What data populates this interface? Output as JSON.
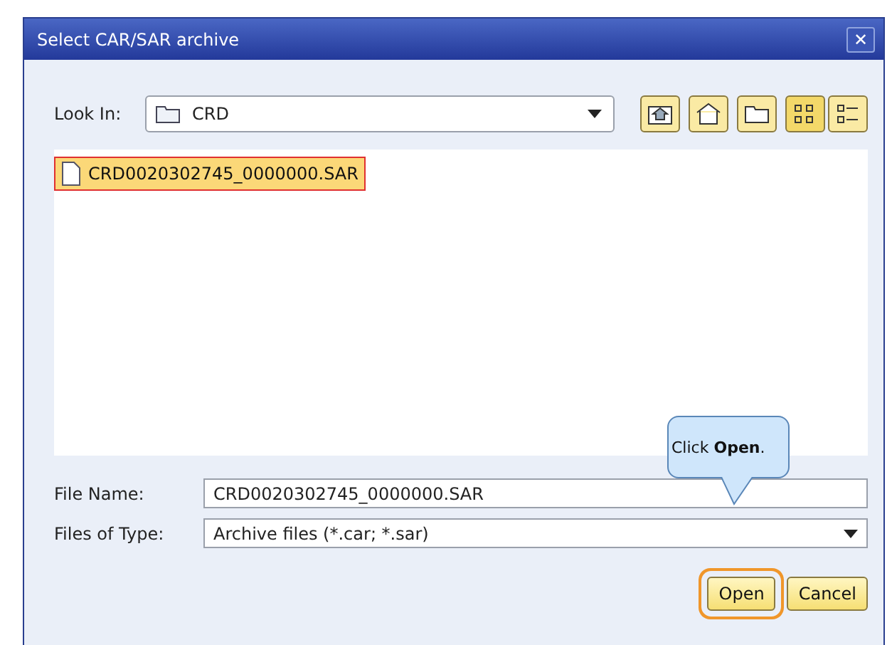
{
  "window": {
    "title": "Select CAR/SAR archive",
    "close": "✕"
  },
  "look_in": {
    "label": "Look In:",
    "value": "CRD"
  },
  "view_buttons": [
    {
      "kind": "list",
      "selected": true
    },
    {
      "kind": "details",
      "selected": false
    }
  ],
  "files": [
    {
      "name": "CRD0020302745_0000000.SAR",
      "selected": true
    }
  ],
  "file_name": {
    "label": "File Name:",
    "value": "CRD0020302745_0000000.SAR"
  },
  "file_type": {
    "label": "Files of Type:",
    "value": "Archive files (*.car; *.sar)"
  },
  "buttons": [
    {
      "label": "Open",
      "highlighted": true
    },
    {
      "label": "Cancel",
      "highlighted": false
    }
  ],
  "callout": {
    "text": "Click **Open**."
  }
}
